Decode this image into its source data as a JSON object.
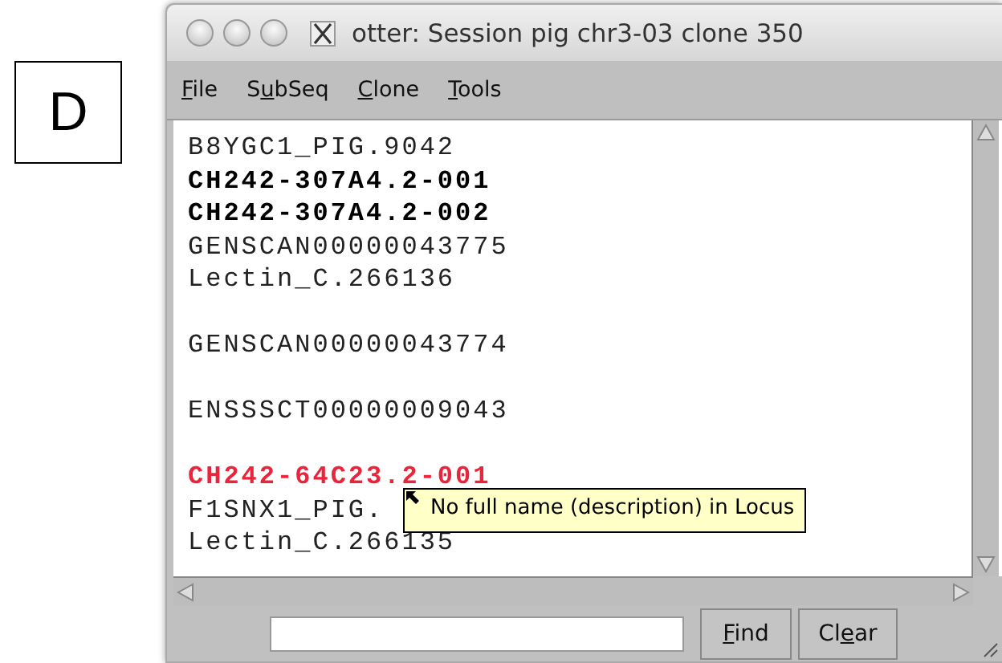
{
  "panel_label": "D",
  "window": {
    "title": "otter: Session pig chr3-03 clone 350"
  },
  "menu": [
    {
      "key": "F",
      "post": "ile"
    },
    {
      "pre": "S",
      "key": "u",
      "post": "bSeq"
    },
    {
      "key": "C",
      "post": "lone"
    },
    {
      "key": "T",
      "post": "ools"
    }
  ],
  "groups": [
    [
      {
        "name": "B8YGC1_PIG.9042",
        "kind": "plain"
      },
      {
        "name": "CH242-307A4.2-001",
        "kind": "bold"
      },
      {
        "name": "CH242-307A4.2-002",
        "kind": "bold"
      },
      {
        "name": "GENSCAN00000043775",
        "kind": "plain"
      },
      {
        "name": "Lectin_C.266136",
        "kind": "plain"
      }
    ],
    [
      {
        "name": "GENSCAN00000043774",
        "kind": "plain"
      }
    ],
    [
      {
        "name": "ENSSSCT00000009043",
        "kind": "plain"
      }
    ],
    [
      {
        "name": "CH242-64C23.2-001",
        "kind": "highlight"
      },
      {
        "name": "F1SNX1_PIG.",
        "kind": "plain"
      },
      {
        "name": "Lectin_C.266135",
        "kind": "plain"
      }
    ]
  ],
  "tooltip": "No full name (description) in Locus",
  "buttons": [
    {
      "key": "F",
      "post": "ind"
    },
    {
      "pre": "Cl",
      "key": "e",
      "post": "ar"
    }
  ]
}
